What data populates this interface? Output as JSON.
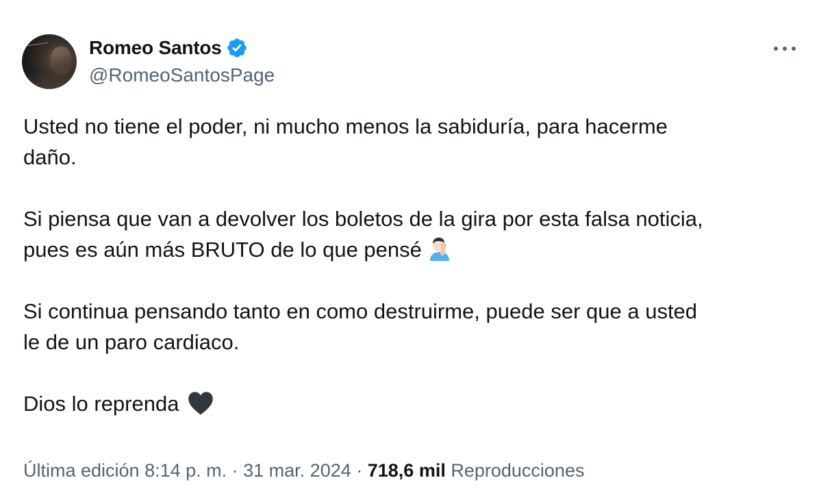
{
  "author": {
    "display_name": "Romeo Santos",
    "handle": "@RomeoSantosPage",
    "verified": true,
    "avatar_icon": "profile-photo"
  },
  "tweet": {
    "paragraphs": [
      [
        "Usted no tiene el poder, ni mucho menos la sabiduría, para hacerme",
        "daño."
      ],
      [
        "Si piensa que van a devolver los boletos de la gira por esta falsa noticia,",
        "pues es aún más BRUTO de lo que pensé"
      ],
      [
        "Si continua pensando tanto en como destruirme, puede ser que a usted",
        "le de un paro cardiaco."
      ],
      [
        "Dios lo reprenda"
      ]
    ],
    "emojis": {
      "para2_end": "facepalm-emoji",
      "para4_end": "black-heart-emoji"
    }
  },
  "meta": {
    "edited_label": "Última edición 8:14 p. m. · 31 mar. 2024 ·",
    "views_count": "718,6 mil",
    "views_label": "Reproducciones"
  },
  "colors": {
    "text": "#0f1419",
    "secondary": "#536471",
    "verified_blue": "#1d9bf0",
    "background": "#ffffff"
  }
}
